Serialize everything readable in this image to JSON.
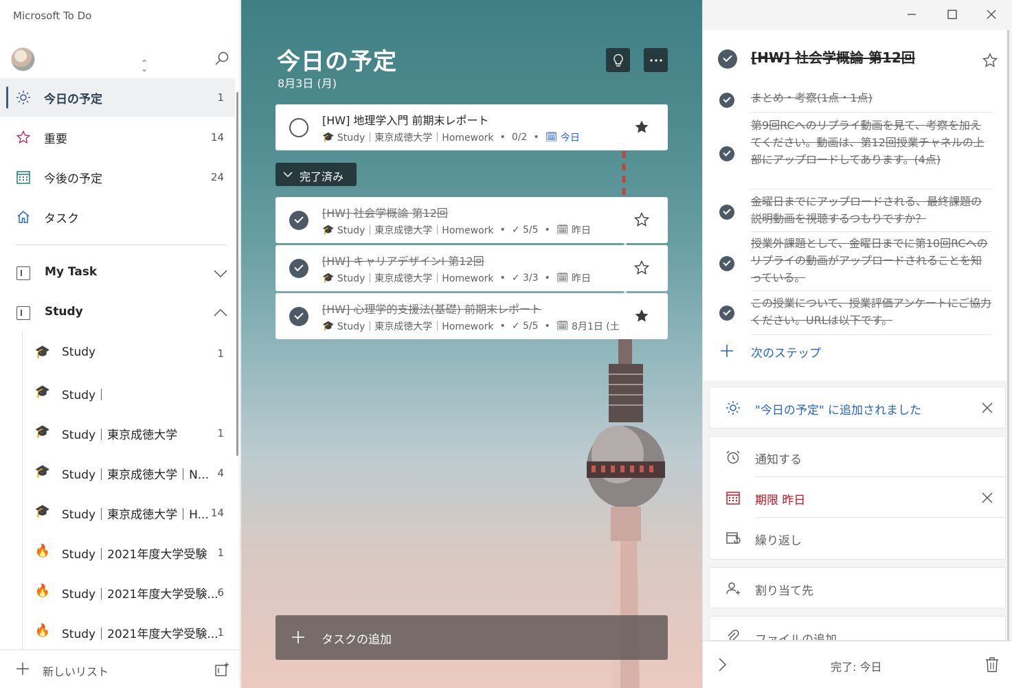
{
  "app": {
    "title": "Microsoft To Do"
  },
  "colors": {
    "accent": "#2564cf",
    "danger": "#c50f1f",
    "dark_btn": "#263a3d",
    "check_fill": "#4d5a66"
  },
  "sidebar": {
    "smart_lists": [
      {
        "label": "今日の予定",
        "count": "1",
        "icon": "sun-icon",
        "active": true
      },
      {
        "label": "重要",
        "count": "14",
        "icon": "star-icon"
      },
      {
        "label": "今後の予定",
        "count": "24",
        "icon": "calendar-icon"
      },
      {
        "label": "タスク",
        "count": "",
        "icon": "home-icon"
      }
    ],
    "groups": [
      {
        "label": "My Task",
        "expanded": false
      },
      {
        "label": "Study",
        "expanded": true
      }
    ],
    "lists": [
      {
        "emoji": "🎓",
        "label": "Study",
        "count": "1"
      },
      {
        "emoji": "🎓",
        "label": "Study｜",
        "count": ""
      },
      {
        "emoji": "🎓",
        "label": "Study｜東京成徳大学",
        "count": "1"
      },
      {
        "emoji": "🎓",
        "label": "Study｜東京成徳大学｜N...",
        "count": "4"
      },
      {
        "emoji": "🎓",
        "label": "Study｜東京成徳大学｜H...",
        "count": "14"
      },
      {
        "emoji": "🔥",
        "label": "Study｜2021年度大学受験",
        "count": "1"
      },
      {
        "emoji": "🔥",
        "label": "Study｜2021年度大学受験...",
        "count": "6"
      },
      {
        "emoji": "🔥",
        "label": "Study｜2021年度大学受験...",
        "count": "1"
      }
    ],
    "new_list_label": "新しいリスト"
  },
  "main": {
    "title": "今日の予定",
    "date": "8月3日 (月)",
    "open_tasks": [
      {
        "title": "[HW] 地理学入門 前期末レポート",
        "list": "Study｜東京成徳大学｜Homework",
        "steps": "0/2",
        "due": "今日",
        "starred": true
      }
    ],
    "completed_label": "完了済み",
    "completed_tasks": [
      {
        "title": "[HW] 社会学概論 第12回",
        "list": "Study｜東京成徳大学｜Homework",
        "steps": "5/5",
        "due": "昨日",
        "starred": false
      },
      {
        "title": "[HW] キャリアデザインⅠ 第12回",
        "list": "Study｜東京成徳大学｜Homework",
        "steps": "3/3",
        "due": "昨日",
        "starred": false
      },
      {
        "title": "[HW] 心理学的支援法(基礎) 前期末レポート",
        "list": "Study｜東京成徳大学｜Homework",
        "steps": "5/5",
        "due": "8月1日 (土",
        "starred": true
      }
    ],
    "add_task_label": "タスクの追加"
  },
  "detail": {
    "title": "[HW] 社会学概論 第12回",
    "steps": [
      {
        "text": "まとめ・考察(1点・1点)"
      },
      {
        "text": "第9回RCへのリプライ動画を見て、考察を加えてください。動画は、第12回授業チャネルの上部にアップロードしてあります。(4点)"
      },
      {
        "text": "金曜日までにアップロードされる、最終課題の説明動画を視聴するつもりですか？"
      },
      {
        "text": "授業外課題として、金曜日までに第10回RCへのリプライの動画がアップロードされることを知っている。"
      },
      {
        "text": "この授業について、授業評価アンケートにご協力ください。URLは以下です。"
      }
    ],
    "next_step_label": "次のステップ",
    "my_day_label": "\"今日の予定\" に追加されました",
    "remind_label": "通知する",
    "due_label": "期限 昨日",
    "repeat_label": "繰り返し",
    "assign_label": "割り当て先",
    "file_label": "ファイルの追加",
    "footer_status": "完了: 今日"
  }
}
